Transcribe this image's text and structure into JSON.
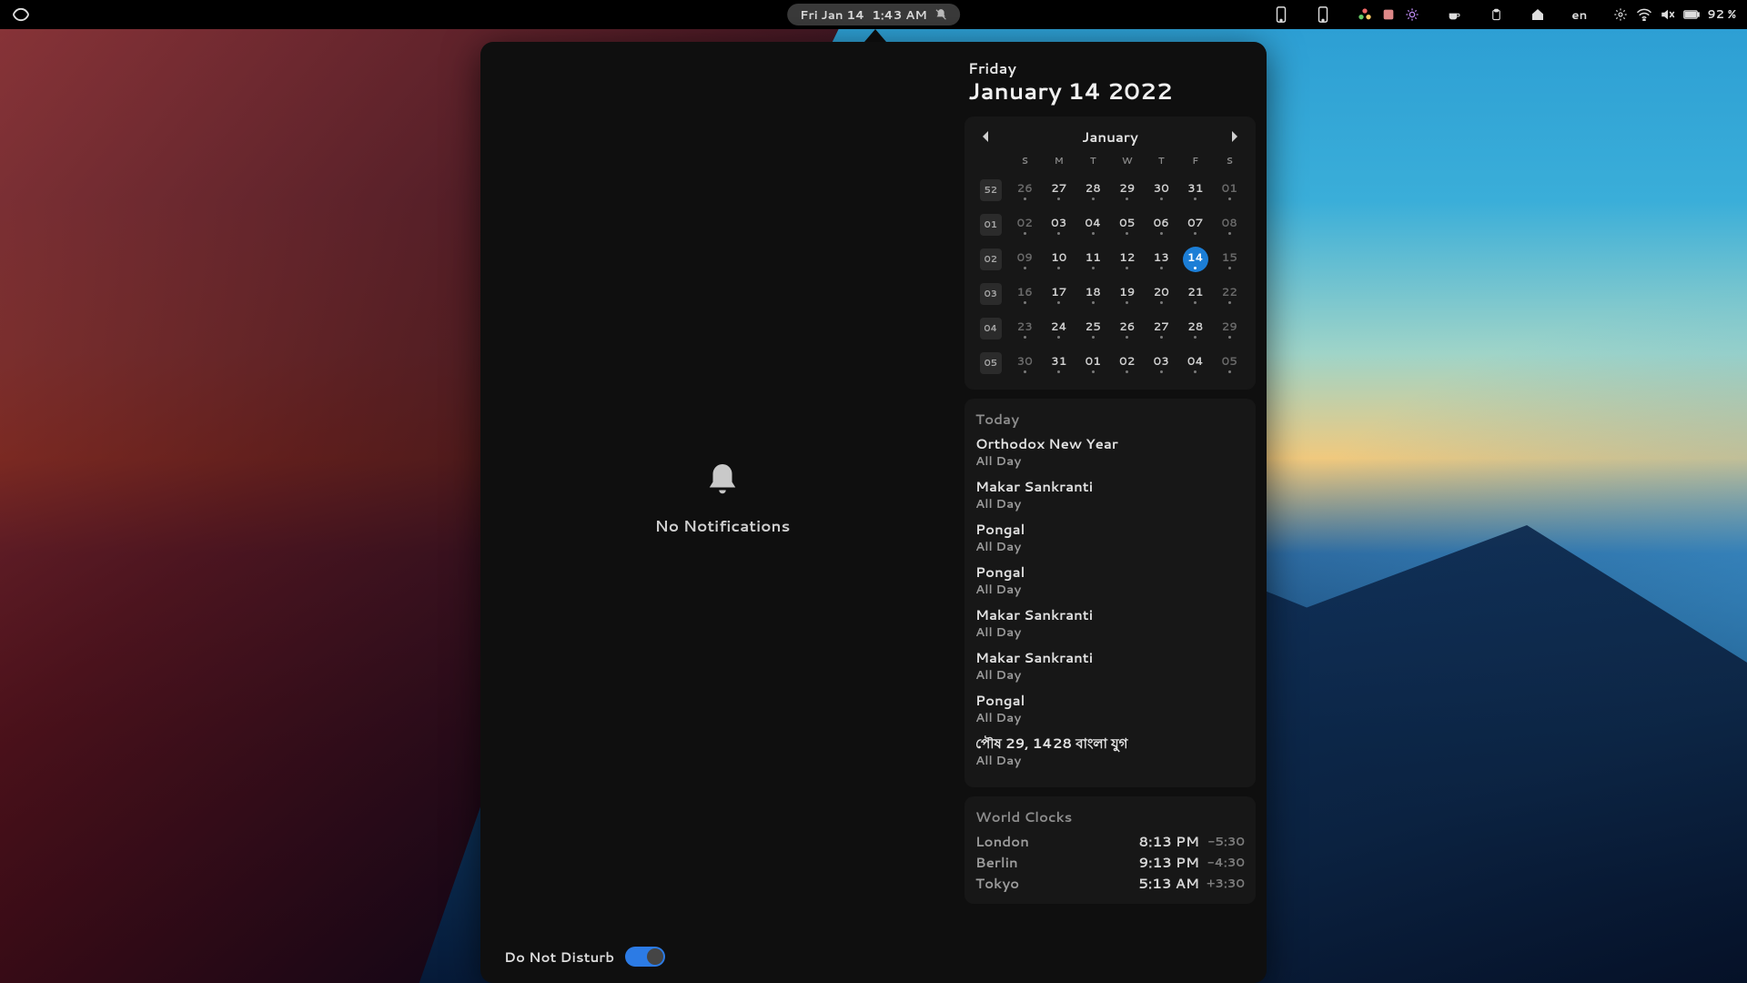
{
  "topbar": {
    "date": "Fri Jan 14",
    "time": "1:43 AM",
    "language": "en",
    "battery_text": "92 %"
  },
  "notifications": {
    "empty_label": "No Notifications",
    "dnd_label": "Do Not Disturb",
    "dnd_on": true
  },
  "date_header": {
    "weekday": "Friday",
    "long_date": "January 14 2022"
  },
  "calendar": {
    "month_label": "January",
    "day_headers": [
      "S",
      "M",
      "T",
      "W",
      "T",
      "F",
      "S"
    ],
    "weeks": [
      {
        "num": "52",
        "days": [
          {
            "d": "26",
            "dim": true,
            "dot": true
          },
          {
            "d": "27",
            "dim": false,
            "dot": true
          },
          {
            "d": "28",
            "dim": false,
            "dot": true
          },
          {
            "d": "29",
            "dim": false,
            "dot": true
          },
          {
            "d": "30",
            "dim": false,
            "dot": true
          },
          {
            "d": "31",
            "dim": false,
            "dot": true
          },
          {
            "d": "01",
            "dim": true,
            "dot": true
          }
        ]
      },
      {
        "num": "01",
        "days": [
          {
            "d": "02",
            "dim": true,
            "dot": true
          },
          {
            "d": "03",
            "dim": false,
            "dot": true
          },
          {
            "d": "04",
            "dim": false,
            "dot": true
          },
          {
            "d": "05",
            "dim": false,
            "dot": true
          },
          {
            "d": "06",
            "dim": false,
            "dot": true
          },
          {
            "d": "07",
            "dim": false,
            "dot": true
          },
          {
            "d": "08",
            "dim": true,
            "dot": true
          }
        ]
      },
      {
        "num": "02",
        "days": [
          {
            "d": "09",
            "dim": true,
            "dot": true
          },
          {
            "d": "10",
            "dim": false,
            "dot": true
          },
          {
            "d": "11",
            "dim": false,
            "dot": true
          },
          {
            "d": "12",
            "dim": false,
            "dot": true
          },
          {
            "d": "13",
            "dim": false,
            "dot": true
          },
          {
            "d": "14",
            "dim": false,
            "dot": true,
            "today": true
          },
          {
            "d": "15",
            "dim": true,
            "dot": true
          }
        ]
      },
      {
        "num": "03",
        "days": [
          {
            "d": "16",
            "dim": true,
            "dot": true
          },
          {
            "d": "17",
            "dim": false,
            "dot": true
          },
          {
            "d": "18",
            "dim": false,
            "dot": true
          },
          {
            "d": "19",
            "dim": false,
            "dot": true
          },
          {
            "d": "20",
            "dim": false,
            "dot": true
          },
          {
            "d": "21",
            "dim": false,
            "dot": true
          },
          {
            "d": "22",
            "dim": true,
            "dot": true
          }
        ]
      },
      {
        "num": "04",
        "days": [
          {
            "d": "23",
            "dim": true,
            "dot": true
          },
          {
            "d": "24",
            "dim": false,
            "dot": true
          },
          {
            "d": "25",
            "dim": false,
            "dot": true
          },
          {
            "d": "26",
            "dim": false,
            "dot": true
          },
          {
            "d": "27",
            "dim": false,
            "dot": true
          },
          {
            "d": "28",
            "dim": false,
            "dot": true
          },
          {
            "d": "29",
            "dim": true,
            "dot": true
          }
        ]
      },
      {
        "num": "05",
        "days": [
          {
            "d": "30",
            "dim": true,
            "dot": true
          },
          {
            "d": "31",
            "dim": false,
            "dot": true
          },
          {
            "d": "01",
            "dim": false,
            "dot": true
          },
          {
            "d": "02",
            "dim": false,
            "dot": true
          },
          {
            "d": "03",
            "dim": false,
            "dot": true
          },
          {
            "d": "04",
            "dim": false,
            "dot": true
          },
          {
            "d": "05",
            "dim": true,
            "dot": true
          }
        ]
      }
    ]
  },
  "events": {
    "section_title": "Today",
    "items": [
      {
        "title": "Orthodox New Year",
        "sub": "All Day"
      },
      {
        "title": "Makar Sankranti",
        "sub": "All Day"
      },
      {
        "title": "Pongal",
        "sub": "All Day"
      },
      {
        "title": "Pongal",
        "sub": "All Day"
      },
      {
        "title": "Makar Sankranti",
        "sub": "All Day"
      },
      {
        "title": "Makar Sankranti",
        "sub": "All Day"
      },
      {
        "title": "Pongal",
        "sub": "All Day"
      },
      {
        "title": "পৌষ 29, 1428 বাংলা যুগ",
        "sub": "All Day"
      }
    ]
  },
  "clocks": {
    "section_title": "World Clocks",
    "items": [
      {
        "city": "London",
        "time": "8:13 PM",
        "offset": "-5:30"
      },
      {
        "city": "Berlin",
        "time": "9:13 PM",
        "offset": "-4:30"
      },
      {
        "city": "Tokyo",
        "time": "5:13 AM",
        "offset": "+3:30"
      }
    ]
  }
}
